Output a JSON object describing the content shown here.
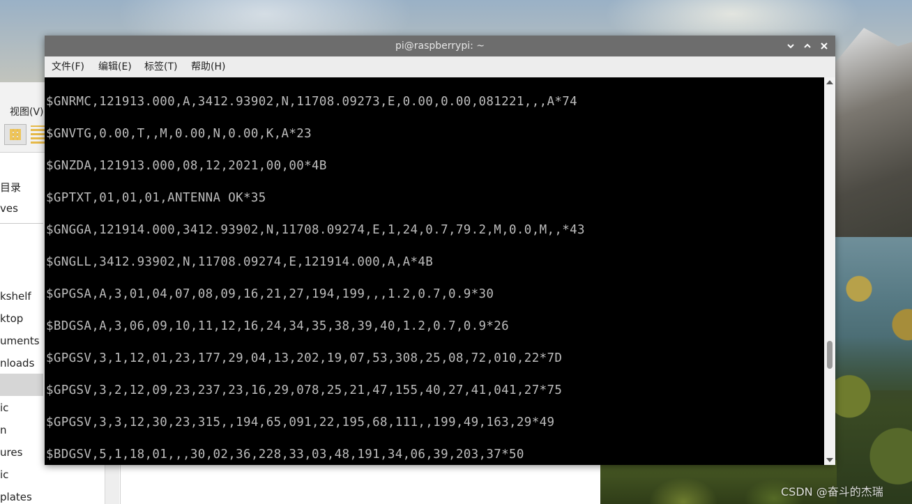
{
  "terminal": {
    "title": "pi@raspberrypi: ~",
    "menu": [
      "文件(F)",
      "编辑(E)",
      "标签(T)",
      "帮助(H)"
    ],
    "lines": [
      "$GNRMC,121913.000,A,3412.93902,N,11708.09273,E,0.00,0.00,081221,,,A*74",
      "$GNVTG,0.00,T,,M,0.00,N,0.00,K,A*23",
      "$GNZDA,121913.000,08,12,2021,00,00*4B",
      "$GPTXT,01,01,01,ANTENNA OK*35",
      "$GNGGA,121914.000,3412.93902,N,11708.09274,E,1,24,0.7,79.2,M,0.0,M,,*43",
      "$GNGLL,3412.93902,N,11708.09274,E,121914.000,A,A*4B",
      "$GPGSA,A,3,01,04,07,08,09,16,21,27,194,199,,,1.2,0.7,0.9*30",
      "$BDGSA,A,3,06,09,10,11,12,16,24,34,35,38,39,40,1.2,0.7,0.9*26",
      "$GPGSV,3,1,12,01,23,177,29,04,13,202,19,07,53,308,25,08,72,010,22*7D",
      "$GPGSV,3,2,12,09,23,237,23,16,29,078,25,21,47,155,40,27,41,041,27*75",
      "$GPGSV,3,3,12,30,23,315,,194,65,091,22,195,68,111,,199,49,163,29*49",
      "$BDGSV,5,1,18,01,,,30,02,36,228,33,03,48,191,34,06,39,203,37*50"
    ]
  },
  "file_manager": {
    "view_menu": "视图(V)",
    "sidebar_items": [
      "目录",
      "ves",
      "kshelf",
      "ktop",
      "uments",
      "nloads",
      "ic",
      "n",
      "ures",
      "ic",
      "plates"
    ]
  },
  "watermark": "CSDN @奋斗的杰瑞",
  "colors": {
    "titlebar": "#6d6d6d",
    "menubar": "#ededed",
    "terminal_bg": "#000000",
    "terminal_text": "#bdbdbd"
  }
}
